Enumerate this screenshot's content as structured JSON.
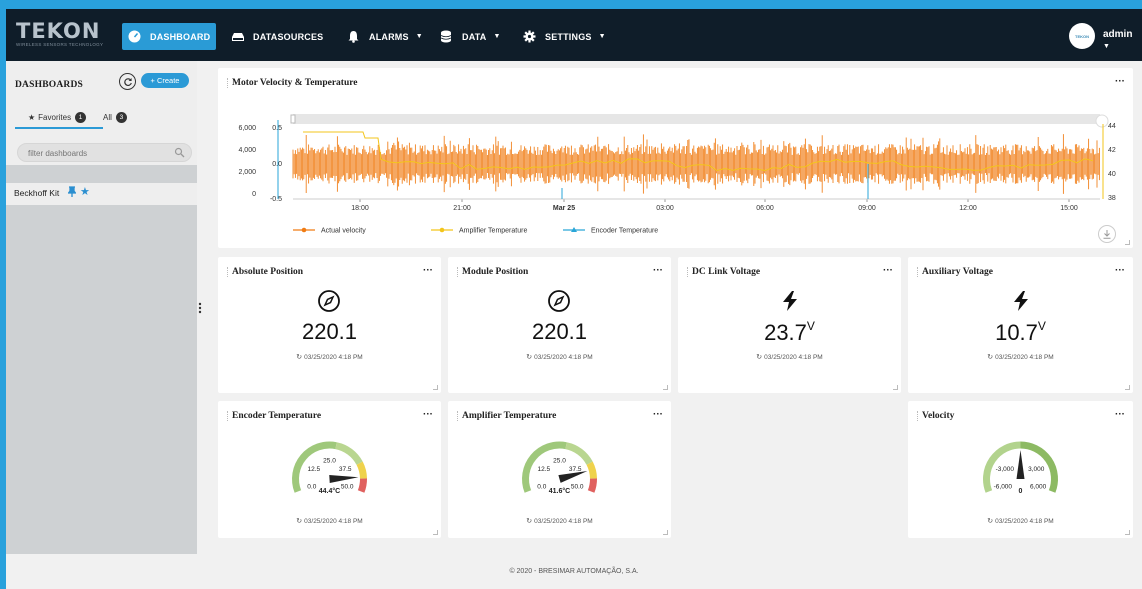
{
  "brand": {
    "name": "TEKON",
    "tagline": "WIRELESS SENSORS TECHNOLOGY",
    "avatar_text": "TEKON"
  },
  "nav": {
    "dashboard": "DASHBOARD",
    "datasources": "DATASOURCES",
    "alarms": "ALARMS",
    "data": "DATA",
    "settings": "SETTINGS"
  },
  "user": {
    "name": "admin"
  },
  "sidebar": {
    "title": "DASHBOARDS",
    "create_label": "+ Create",
    "tabs": [
      {
        "label": "Favorites",
        "count": "1"
      },
      {
        "label": "All",
        "count": "3"
      }
    ],
    "filter_placeholder": "filter dashboards",
    "items": [
      {
        "label": "Beckhoff Kit"
      }
    ]
  },
  "widgets": {
    "motor_chart": {
      "title": "Motor Velocity & Temperature"
    },
    "absolute_position": {
      "title": "Absolute Position",
      "value": "220.1",
      "unit": "",
      "timestamp": "03/25/2020 4:18 PM"
    },
    "module_position": {
      "title": "Module Position",
      "value": "220.1",
      "unit": "",
      "timestamp": "03/25/2020 4:18 PM"
    },
    "dc_link_voltage": {
      "title": "DC Link Voltage",
      "value": "23.7",
      "unit": "V",
      "timestamp": "03/25/2020 4:18 PM"
    },
    "aux_voltage": {
      "title": "Auxiliary Voltage",
      "value": "10.7",
      "unit": "V",
      "timestamp": "03/25/2020 4:18 PM"
    },
    "encoder_temp": {
      "title": "Encoder Temperature",
      "value": "44.4°C",
      "timestamp": "03/25/2020 4:18 PM",
      "min": "0.0",
      "q1": "12.5",
      "mid": "25.0",
      "q3": "37.5",
      "max": "50.0",
      "reading": 44.4
    },
    "amplifier_temp": {
      "title": "Amplifier Temperature",
      "value": "41.6°C",
      "timestamp": "03/25/2020 4:18 PM",
      "min": "0.0",
      "q1": "12.5",
      "mid": "25.0",
      "q3": "37.5",
      "max": "50.0",
      "reading": 41.6
    },
    "velocity": {
      "title": "Velocity",
      "value": "0",
      "timestamp": "03/25/2020 4:18 PM",
      "min": "-6,000",
      "q1": "-3,000",
      "q3": "3,000",
      "max": "6,000",
      "reading": 0
    }
  },
  "chart_data": {
    "type": "line",
    "title": "Motor Velocity & Temperature",
    "x_ticks": [
      "18:00",
      "21:00",
      "Mar 25",
      "03:00",
      "06:00",
      "09:00",
      "12:00",
      "15:00"
    ],
    "y_left_outer_ticks": [
      "6,000",
      "4,000",
      "2,000",
      "0"
    ],
    "y_left_inner_ticks": [
      "0.5",
      "0.0",
      "-0.5"
    ],
    "y_right_ticks": [
      "44",
      "42",
      "40",
      "38"
    ],
    "series": [
      {
        "name": "Actual velocity",
        "color": "#f07c14"
      },
      {
        "name": "Amplifier Temperature",
        "color": "#f3c51b"
      },
      {
        "name": "Encoder Temperature",
        "color": "#2aa6d8"
      }
    ]
  },
  "footer": "© 2020 - BRESIMAR AUTOMAÇÃO, S.A."
}
